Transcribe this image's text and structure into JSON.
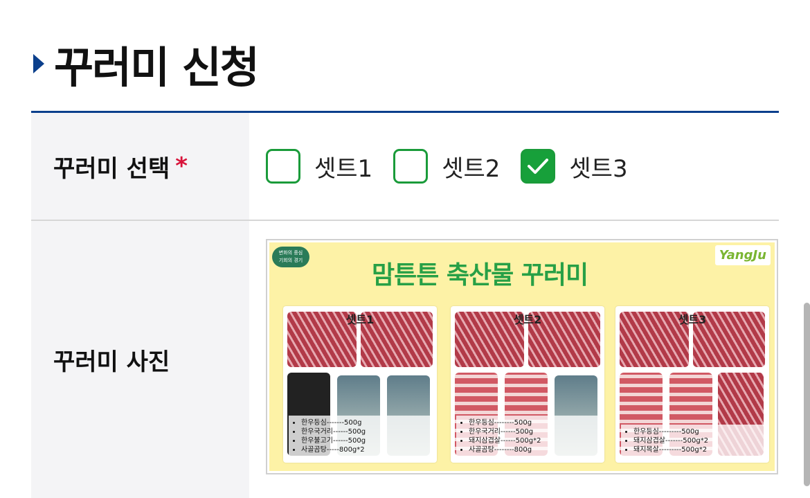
{
  "page": {
    "title": "꾸러미 신청"
  },
  "select_row": {
    "label": "꾸러미 선택",
    "required_mark": "*",
    "options": [
      {
        "label": "셋트1",
        "checked": false
      },
      {
        "label": "셋트2",
        "checked": false
      },
      {
        "label": "셋트3",
        "checked": true
      }
    ]
  },
  "photo_row": {
    "label": "꾸러미 사진",
    "banner": {
      "heading": "맘튼튼 축산물 꾸러미",
      "city_logo": "YangJu",
      "badge_logo": "변화의 중심\n기회의 경기",
      "sets": [
        {
          "name": "셋트1",
          "items": [
            "한우등심-------500g",
            "한우국거리------500g",
            "한우불고기------500g",
            "사골곰탕-----800g*2"
          ]
        },
        {
          "name": "셋트2",
          "items": [
            "한우등심--------500g",
            "한우국거리------500g",
            "돼지삼겹살------500g*2",
            "사골곰탕--------800g"
          ]
        },
        {
          "name": "셋트3",
          "items": [
            "한우등심---------500g",
            "돼지삼겹살-------500g*2",
            "돼지목살---------500g*2"
          ]
        }
      ]
    }
  },
  "colors": {
    "accent_blue": "#0b3f8c",
    "check_green": "#17a03a",
    "required_red": "#d8143a",
    "label_bg": "#f4f4f6"
  }
}
